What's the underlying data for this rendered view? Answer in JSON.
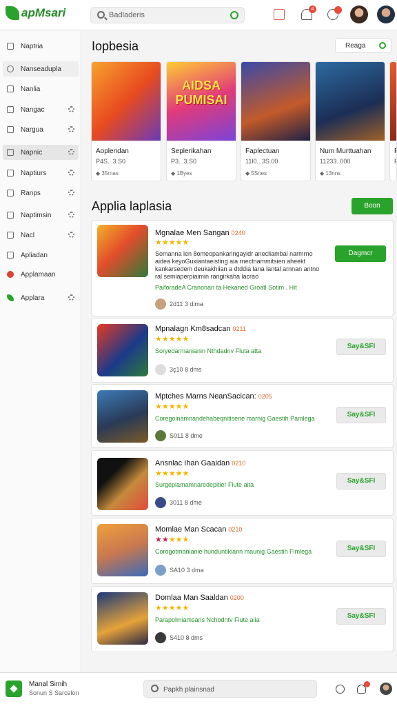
{
  "header": {
    "logo_text": "apMsari",
    "search_placeholder": "Badladeris",
    "notification_count": "4"
  },
  "sidebar": {
    "items": [
      {
        "label": "Naptria",
        "icon": "list-icon"
      },
      {
        "label": "Nanseadupla",
        "icon": "search-icon"
      },
      {
        "label": "Nanlia",
        "icon": "home-icon"
      },
      {
        "label": "Nangac",
        "icon": "chart-icon"
      },
      {
        "label": "Nargua",
        "icon": "trend-icon"
      },
      {
        "label": "Napnic",
        "icon": "cart-icon"
      },
      {
        "label": "Naptiurs",
        "icon": "box-icon"
      },
      {
        "label": "Ranps",
        "icon": "bag-icon"
      },
      {
        "label": "Naptimsin",
        "icon": "check-icon"
      },
      {
        "label": "Nacl",
        "icon": "doc-icon"
      },
      {
        "label": "Apliadan",
        "icon": "file-icon"
      },
      {
        "label": "Applamaan",
        "icon": "red-circle-icon"
      },
      {
        "label": "Applara",
        "icon": "green-leaf-icon"
      }
    ]
  },
  "featured": {
    "title": "Iopbesia",
    "select_label": "Reaga",
    "cards": [
      {
        "thumb_text": "",
        "title": "Aopleridan",
        "price": "P4S...3.S0",
        "meta": "35rnas"
      },
      {
        "thumb_text": "AIDSA PUMISAI",
        "title": "Seplerikahan",
        "price": "P3...3.S0",
        "meta": "1Byes"
      },
      {
        "thumb_text": "",
        "title": "Faplectuan",
        "price": "11l0...3S.00",
        "meta": "5Snes"
      },
      {
        "thumb_text": "",
        "title": "Num Murttuahan",
        "price": "11233..000",
        "meta": "13nns"
      },
      {
        "thumb_text": "",
        "title": "P",
        "price": "P",
        "meta": ""
      }
    ]
  },
  "apps": {
    "title": "Applia laplasia",
    "boon_label": "Boon",
    "items": [
      {
        "name": "Mgnalae Men Sangan",
        "score": "0240",
        "stars_on": 5,
        "desc": "Somanna len 8omeopankaringayidr anecliambal narmrno aidea keyoGuxiantaeisting aia rnectnammitsien aheekt kankarsedem deukakhlian a dtddia lana lantal arnnan antno ral semiaperpiaimin rangirkaha lacrao",
        "green": "PaiforadeA Cranonan ta Hekaned Groatl Sotim . Hit",
        "meta": "2d11 3 dima",
        "button": "Dagmcr",
        "button_style": "green"
      },
      {
        "name": "Mpnalagn Km8sadcan",
        "score": "0211",
        "stars_on": 5,
        "desc": "",
        "green": "Soryedarmanianin Nthdadnv Fluta atta",
        "meta": "3ç10 8 dms",
        "button": "Say&SFI",
        "button_style": "gray"
      },
      {
        "name": "Mptches Marns NeanSacican:",
        "score": "0205",
        "stars_on": 5,
        "desc": "",
        "green": "Coregoinamnandehabeqnitisene marnig Gaestih Pamlega",
        "meta": "S011 8 dme",
        "button": "Say&SFI",
        "button_style": "gray"
      },
      {
        "name": "Ansnlac Ihan Gaaidan",
        "score": "0210",
        "stars_on": 5,
        "desc": "",
        "green": "Surgepiamamnaredepitier Fiute aita",
        "meta": "3011 8 dme",
        "button": "Say&SFI",
        "button_style": "gray"
      },
      {
        "name": "Momlae Man Scacan",
        "score": "0210",
        "stars_on": 2,
        "desc": "",
        "green": "Corogotmanianie hunduntikiann maunig Gaestih Fimlega",
        "meta": "SA10 3 dma",
        "button": "Say&SFI",
        "button_style": "gray"
      },
      {
        "name": "Domlaa Man Saaldan",
        "score": "0200",
        "stars_on": 5,
        "desc": "",
        "green": "Parapolmiamsaris Nchodntv Fiute aiia",
        "meta": "S410 8 dms",
        "button": "Say&SFI",
        "button_style": "gray"
      }
    ]
  },
  "footer": {
    "name": "Manal Simih",
    "sub": "Sonun S Sarcelon",
    "search_placeholder": "Papkh plainsnad"
  },
  "colors": {
    "accent": "#2aa32c",
    "star": "#f4b400",
    "badge": "#e84a3c",
    "score": "#e26a2a"
  }
}
